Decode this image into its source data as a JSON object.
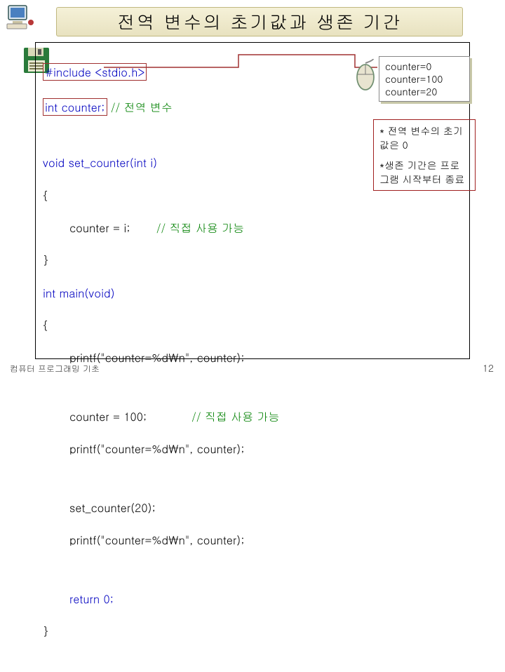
{
  "title": "전역 변수의 초기값과 생존 기간",
  "code": {
    "l1": "#include <stdio.h>",
    "l2a": "int counter;",
    "l2b": " // 전역 변수",
    "l3": "void set_counter(int i)",
    "l4": "{",
    "l5a": "counter = i;",
    "l5b": "// 직접 사용 가능",
    "l6": "}",
    "l7": "int main(void)",
    "l8": "{",
    "l9": "printf(\"counter=%d\\n\", counter);",
    "l10a": "counter = 100;",
    "l10b": "// 직접 사용 가능",
    "l11": "printf(\"counter=%d\\n\", counter);",
    "l12": "set_counter(20);",
    "l13": "printf(\"counter=%d\\n\", counter);",
    "l14": "return 0;",
    "l15": "}"
  },
  "output": {
    "o1": "counter=0",
    "o2": "counter=100",
    "o3": "counter=20"
  },
  "notes": {
    "n1": "* 전역 변수의 초기값은 0",
    "n2": "*생존 기간은 프로그램 시작부터 종료"
  },
  "footer": "컴퓨터 프로그래밍 기초",
  "page": "12"
}
